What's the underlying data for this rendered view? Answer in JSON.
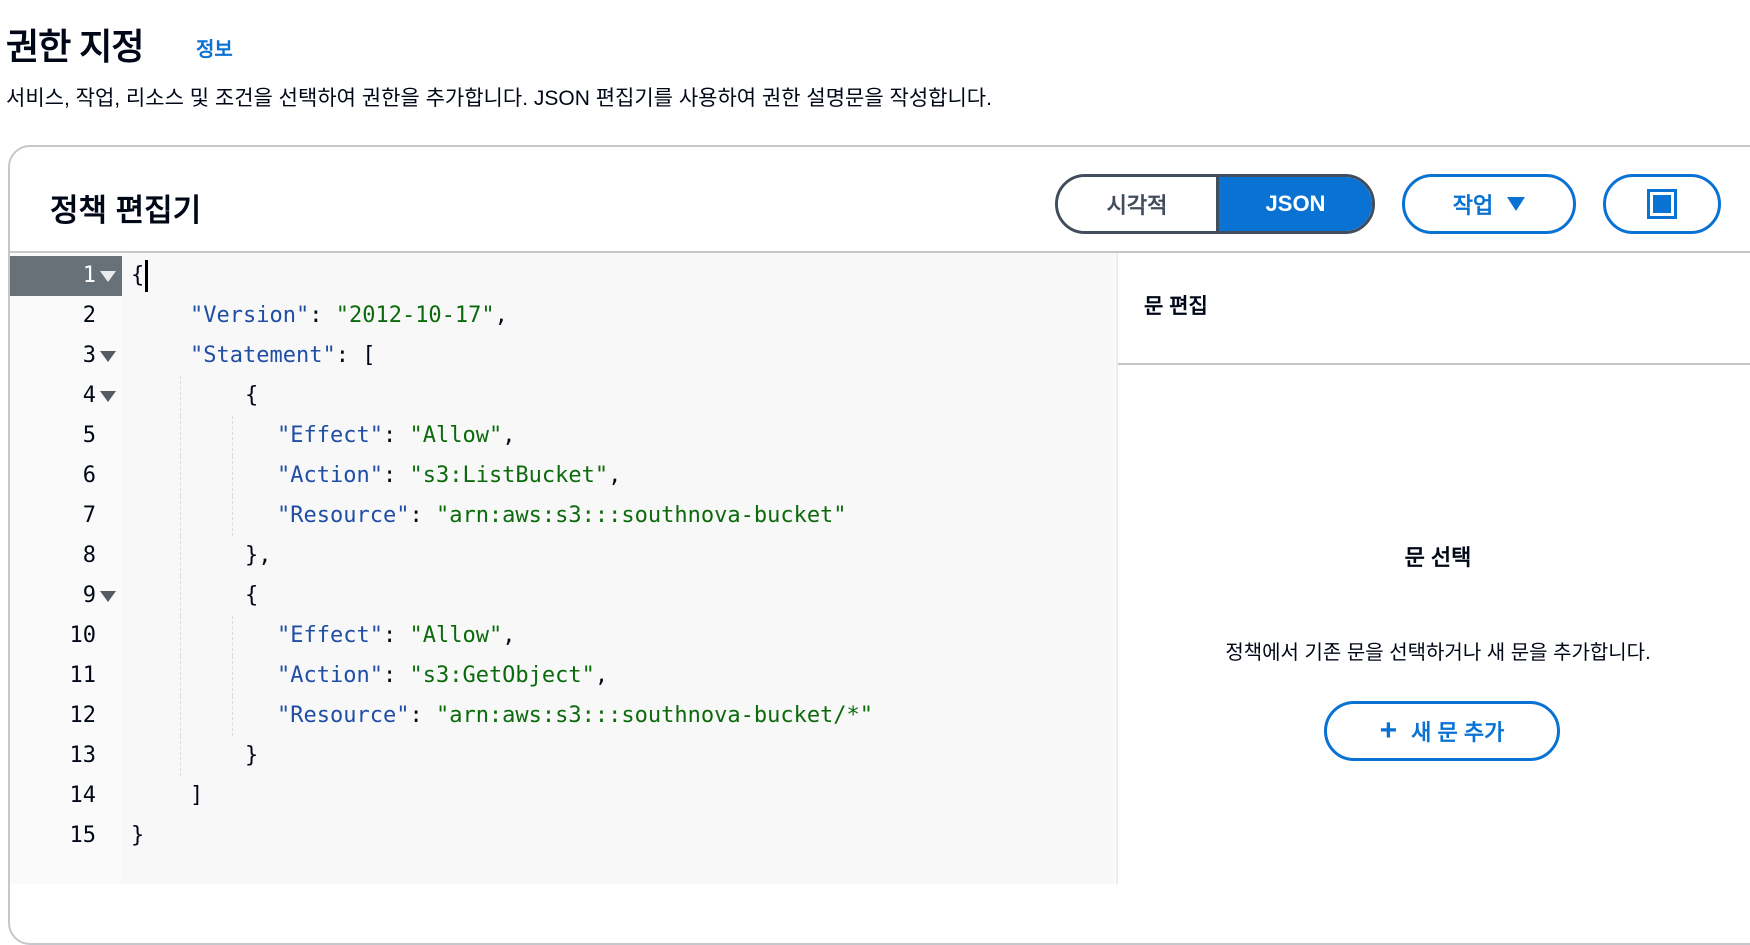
{
  "header": {
    "title": "권한 지정",
    "info_link": "정보",
    "description": "서비스, 작업, 리소스 및 조건을 선택하여 권한을 추가합니다. JSON 편집기를 사용하여 권한 설명문을 작성합니다."
  },
  "editor": {
    "title": "정책 편집기",
    "modes": {
      "visual": "시각적",
      "json": "JSON",
      "selected": "JSON"
    },
    "actions_label": "작업",
    "colors": {
      "accent": "#0972d3",
      "key": "#1f4ea3",
      "string": "#0b6a0b"
    },
    "lines": [
      {
        "n": "1",
        "fold": true,
        "indent": 0,
        "parts": [
          [
            "p",
            "{"
          ]
        ]
      },
      {
        "n": "2",
        "indent": 1,
        "parts": [
          [
            "k",
            "\"Version\""
          ],
          [
            "p",
            ": "
          ],
          [
            "s",
            "\"2012-10-17\""
          ],
          [
            "p",
            ","
          ]
        ]
      },
      {
        "n": "3",
        "fold": true,
        "indent": 1,
        "parts": [
          [
            "k",
            "\"Statement\""
          ],
          [
            "p",
            ": ["
          ]
        ]
      },
      {
        "n": "4",
        "fold": true,
        "indent": 2,
        "parts": [
          [
            "p",
            "{"
          ]
        ]
      },
      {
        "n": "5",
        "indent": 3,
        "parts": [
          [
            "k",
            "\"Effect\""
          ],
          [
            "p",
            ": "
          ],
          [
            "s",
            "\"Allow\""
          ],
          [
            "p",
            ","
          ]
        ]
      },
      {
        "n": "6",
        "indent": 3,
        "parts": [
          [
            "k",
            "\"Action\""
          ],
          [
            "p",
            ": "
          ],
          [
            "s",
            "\"s3:ListBucket\""
          ],
          [
            "p",
            ","
          ]
        ]
      },
      {
        "n": "7",
        "indent": 3,
        "parts": [
          [
            "k",
            "\"Resource\""
          ],
          [
            "p",
            ": "
          ],
          [
            "s",
            "\"arn:aws:s3:::southnova-bucket\""
          ]
        ]
      },
      {
        "n": "8",
        "indent": 2,
        "parts": [
          [
            "p",
            "},"
          ]
        ]
      },
      {
        "n": "9",
        "fold": true,
        "indent": 2,
        "parts": [
          [
            "p",
            "{"
          ]
        ]
      },
      {
        "n": "10",
        "indent": 3,
        "parts": [
          [
            "k",
            "\"Effect\""
          ],
          [
            "p",
            ": "
          ],
          [
            "s",
            "\"Allow\""
          ],
          [
            "p",
            ","
          ]
        ]
      },
      {
        "n": "11",
        "indent": 3,
        "parts": [
          [
            "k",
            "\"Action\""
          ],
          [
            "p",
            ": "
          ],
          [
            "s",
            "\"s3:GetObject\""
          ],
          [
            "p",
            ","
          ]
        ]
      },
      {
        "n": "12",
        "indent": 3,
        "parts": [
          [
            "k",
            "\"Resource\""
          ],
          [
            "p",
            ": "
          ],
          [
            "s",
            "\"arn:aws:s3:::southnova-bucket/*\""
          ]
        ]
      },
      {
        "n": "13",
        "indent": 2,
        "parts": [
          [
            "p",
            "}"
          ]
        ]
      },
      {
        "n": "14",
        "indent": 1,
        "parts": [
          [
            "p",
            "]"
          ]
        ]
      },
      {
        "n": "15",
        "indent": 0,
        "parts": [
          [
            "p",
            "}"
          ]
        ]
      }
    ]
  },
  "statement_panel": {
    "title": "문 편집",
    "empty_title": "문 선택",
    "empty_description": "정책에서 기존 문을 선택하거나 새 문을 추가합니다.",
    "add_button": "새 문 추가"
  }
}
